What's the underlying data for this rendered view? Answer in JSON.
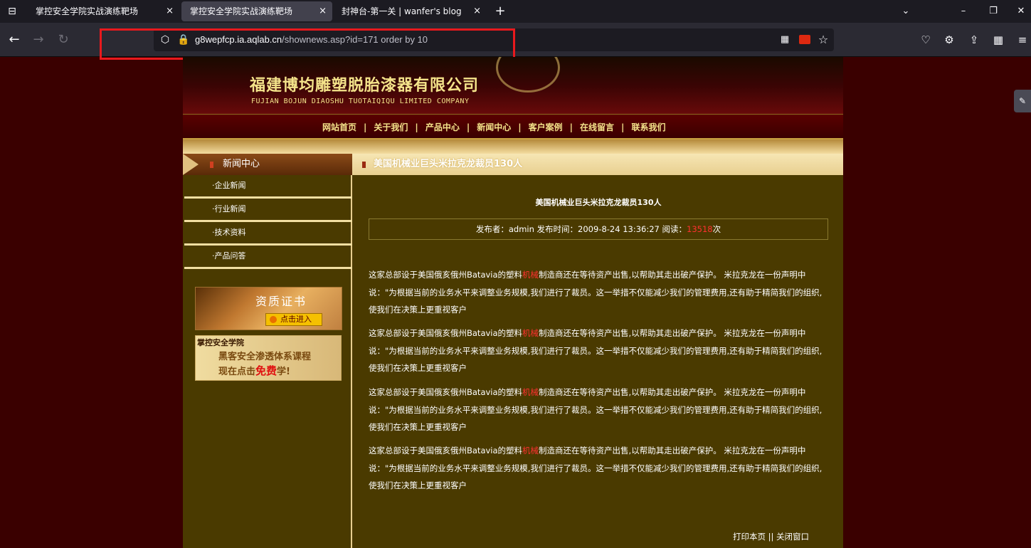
{
  "browser": {
    "tabs": [
      {
        "title": "掌控安全学院实战演练靶场",
        "close": "×"
      },
      {
        "title": "掌控安全学院实战演练靶场",
        "close": "×"
      },
      {
        "title": "封神台-第一关 | wanfer's blog",
        "close": "×"
      }
    ],
    "active_tab": 1,
    "new_tab": "+",
    "url": {
      "host": "g8wepfcp.ia.aqlab.cn",
      "path": "/shownews.asp?id=171 order by 10"
    },
    "icons": {
      "tab_list": "⊟",
      "back": "←",
      "forward": "→",
      "reload": "↻",
      "shield": "⬡",
      "lock": "🔒",
      "qr": "▦",
      "star": "☆",
      "pocket": "♡",
      "extension": "⚙",
      "share": "⇪",
      "grid": "▦",
      "menu": "≡",
      "minimize": "–",
      "restore": "❐",
      "close": "✕",
      "dropdown": "⌄",
      "side": "✎"
    }
  },
  "site": {
    "company_cn": "福建博均雕塑脱胎漆器有限公司",
    "company_en": "FUJIAN BOJUN DIAOSHU  TUOTAIQIQU  LIMITED COMPANY",
    "menu": [
      "网站首页",
      "关于我们",
      "产品中心",
      "新闻中心",
      "客户案例",
      "在线留言",
      "联系我们"
    ],
    "menu_sep": "|",
    "sidebar": {
      "title": "新闻中心",
      "items": [
        "·企业新闻",
        "·行业新闻",
        "·技术资料",
        "·产品问答"
      ],
      "banner1": {
        "title": "资质证书",
        "button": "点击进入"
      },
      "banner2": {
        "brand": "掌控安全学院",
        "line1": "黑客安全渗透体系课程",
        "line2_prefix": "现在点击",
        "line2_free": "免费",
        "line2_suffix": "学!"
      }
    },
    "article": {
      "header_title": "美国机械业巨头米拉克龙裁员130人",
      "title": "美国机械业巨头米拉克龙裁员130人",
      "meta_prefix": "发布者：admin 发布时间：2009-8-24 13:36:27 阅读：",
      "read_count": "13518",
      "meta_suffix": "次",
      "para_a": "这家总部设于美国俄亥俄州Batavia的塑料",
      "para_kw": "机械",
      "para_b": "制造商还在等待资产出售,以帮助其走出破产保护。 米拉克龙在一份声明中说：\"为根据当前的业务水平来调整业务规模,我们进行了裁员。这一举措不仅能减少我们的管理费用,还有助于精简我们的组织,使我们在决策上更重视客户",
      "footer": "打印本页 || 关闭窗口"
    }
  }
}
